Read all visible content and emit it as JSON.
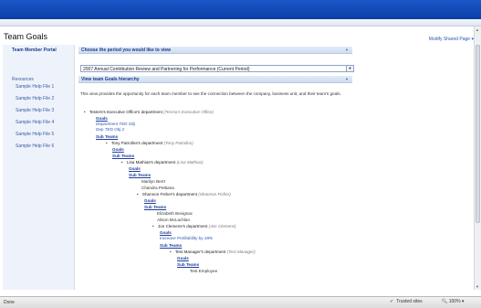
{
  "page": {
    "title": "Team Goals",
    "modify_link": "Modify Shared Page ▾"
  },
  "leftnav": {
    "header": "Team Member Portal",
    "group": "Resources",
    "items": [
      "Sample Help File 1",
      "Sample Help File 2",
      "Sample Help File 3",
      "Sample Help File 4",
      "Sample Help File 5",
      "Sample Help File 6"
    ]
  },
  "webpart1": {
    "title": "Choose the period you would like to view"
  },
  "period": {
    "selected": "2007 Annual Contribution Review and Partnering for Performance (Current Period)"
  },
  "webpart2": {
    "title": "View team Goals hierarchy"
  },
  "description": "This view provides the opportunity for each team member to see the connection between the company, business unit, and their team's goals.",
  "tree": {
    "exec_dept": "Testers's Executive Office's department",
    "exec_mgr": "(Tesrna's Executive Office)",
    "goals": "Goals",
    "exec_obj1": "Department TED Obj",
    "exec_obj2": "Dep TED Obj 2",
    "subteams": "Sub Teams",
    "tony_dept": "Tony Patrollos's department",
    "tony_mgr": "(Tony Patrollos)",
    "lisa_dept": "Lisa Mathias's department",
    "lisa_mgr": "(Lisa Mathias)",
    "member1": "Marilyn Berrt",
    "member2": "Chandra Pettiana",
    "shannon_dept": "Shannon Fisher's department",
    "shannon_mgr": "(Shannon Fisher)",
    "member3": "Elizabeth Bevignac",
    "member4": "Alison McLachlan",
    "jon_dept": "Jon Clemens's department",
    "jon_mgr": "(Jon Clemens)",
    "jon_obj": "Increase Profitability by 18%",
    "test_dept": "Test Manager's department",
    "test_mgr": "(Test Manager)",
    "member5": "Test Employee"
  },
  "status": {
    "left": "Done",
    "zone": "Trusted sites",
    "zoom": "100%"
  },
  "colors": {
    "banner": "#1a57c8",
    "link": "#1f3f9c",
    "nav_bg": "#eef3fb"
  }
}
